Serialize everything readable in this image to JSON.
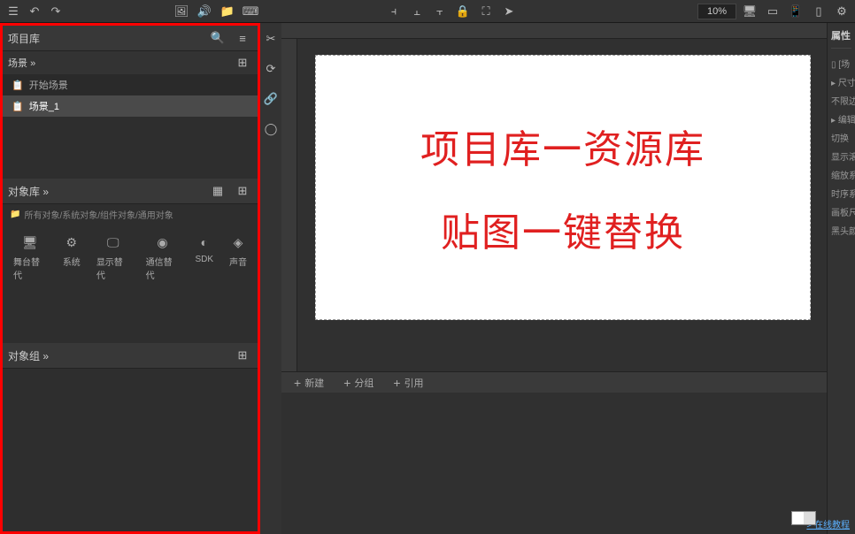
{
  "topbar": {
    "zoom": "10%"
  },
  "leftPanel": {
    "projectLib": {
      "title": "项目库",
      "scene": {
        "label": "场景",
        "expand": "»",
        "items": [
          {
            "icon": "📋",
            "label": "开始场景"
          },
          {
            "icon": "📋",
            "label": "场景_1"
          }
        ]
      }
    },
    "objectLib": {
      "title": "对象库",
      "expand": "»",
      "breadcrumb": "所有对象/系统对象/组件对象/通用对象",
      "items": [
        {
          "icon": "🖥",
          "label": "舞台替代"
        },
        {
          "icon": "⚙",
          "label": "系统"
        },
        {
          "icon": "🖵",
          "label": "显示替代"
        },
        {
          "icon": "◉",
          "label": "通信替代"
        },
        {
          "icon": "◐",
          "label": "SDK"
        },
        {
          "icon": "◈",
          "label": "声音"
        }
      ]
    },
    "groupPanel": {
      "title": "对象组",
      "expand": "»"
    }
  },
  "canvas": {
    "line1": "项目库一资源库",
    "line2": "贴图一键替换"
  },
  "bottomBar": {
    "btn1": "新建",
    "btn2": "分组",
    "btn3": "引用"
  },
  "rightPanel": {
    "title": "属性",
    "items": [
      "[场",
      "尺寸",
      "不限边界",
      "编辑",
      "切换",
      "显示滚动",
      "缩放系数",
      "时序系数",
      "画板尺寸",
      "黑头颜色"
    ],
    "link": "> 在线教程"
  }
}
